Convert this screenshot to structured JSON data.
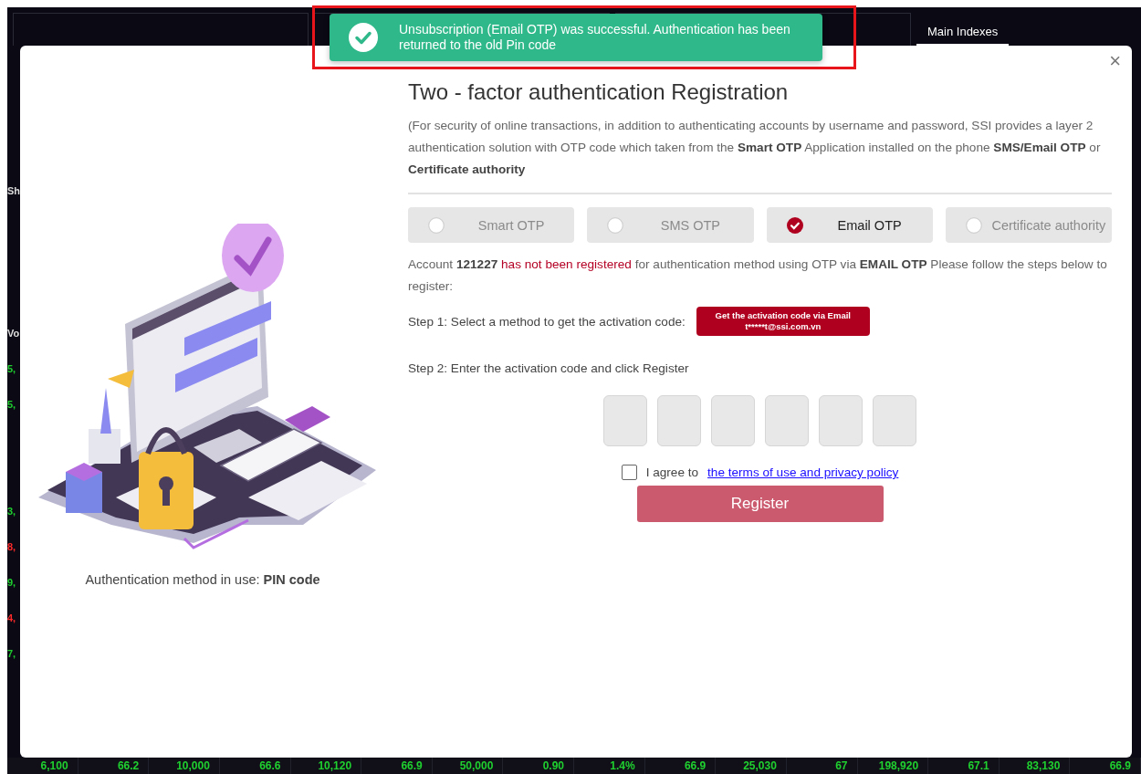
{
  "backdrop": {
    "tab": "Main Indexes",
    "left_headers": [
      "Sh",
      "Vo"
    ],
    "left_fragments": [
      {
        "text": "5,",
        "color": "#1fd02f"
      },
      {
        "text": "5,",
        "color": "#1fd02f"
      },
      {
        "text": "3,",
        "color": "#1fd02f"
      },
      {
        "text": "8,",
        "color": "#ff2a2a"
      },
      {
        "text": "9,",
        "color": "#1fd02f"
      },
      {
        "text": "4,",
        "color": "#ff2a2a"
      },
      {
        "text": "7,",
        "color": "#1fd02f"
      }
    ],
    "bottom_row": [
      "6,100",
      "66.2",
      "10,000",
      "66.6",
      "10,120",
      "66.9",
      "50,000",
      "0.90",
      "1.4%",
      "66.9",
      "25,030",
      "67",
      "198,920",
      "67.1",
      "83,130",
      "66.9"
    ]
  },
  "toast": {
    "kind": "success",
    "message": "Unsubscription (Email OTP) was successful. Authentication has been returned to the old Pin code",
    "highlighted": true
  },
  "modal": {
    "close": "×",
    "title": "Two - factor authentication Registration",
    "intro": "(For security of online transactions, in addition to authenticating accounts by username and password, SSI provides a layer 2 authentication solution with OTP code which taken from the **Smart OTP** Application installed on the phone **SMS/Email OTP** or **Certificate authority**",
    "methods": [
      {
        "label": "Smart OTP",
        "selected": false
      },
      {
        "label": "SMS OTP",
        "selected": false
      },
      {
        "label": "Email OTP",
        "selected": true
      },
      {
        "label": "Certificate authority",
        "selected": false
      }
    ],
    "account_notice": [
      {
        "kind": "plain",
        "text": "Account "
      },
      {
        "kind": "bold",
        "text": "121227"
      },
      {
        "kind": "alert",
        "text": " has not been registered"
      },
      {
        "kind": "plain",
        "text": " for authentication method using OTP via "
      },
      {
        "kind": "bold",
        "text": "EMAIL OTP"
      },
      {
        "kind": "plain",
        "text": " Please follow the steps below to register:"
      }
    ],
    "step1": {
      "label": "Step 1:  Select a method to get the activation code:",
      "button_line1": "Get the activation code via Email",
      "button_line2": "t*****t@ssi.com.vn"
    },
    "step2": {
      "label": "Step 2:  Enter the activation code and click Register"
    },
    "agree": {
      "checked": false,
      "text": "I agree to",
      "link": "the terms of use and privacy policy"
    },
    "register": {
      "label": "Register",
      "disabled": true
    },
    "current_method": "Authentication method in use: **PIN code**"
  }
}
